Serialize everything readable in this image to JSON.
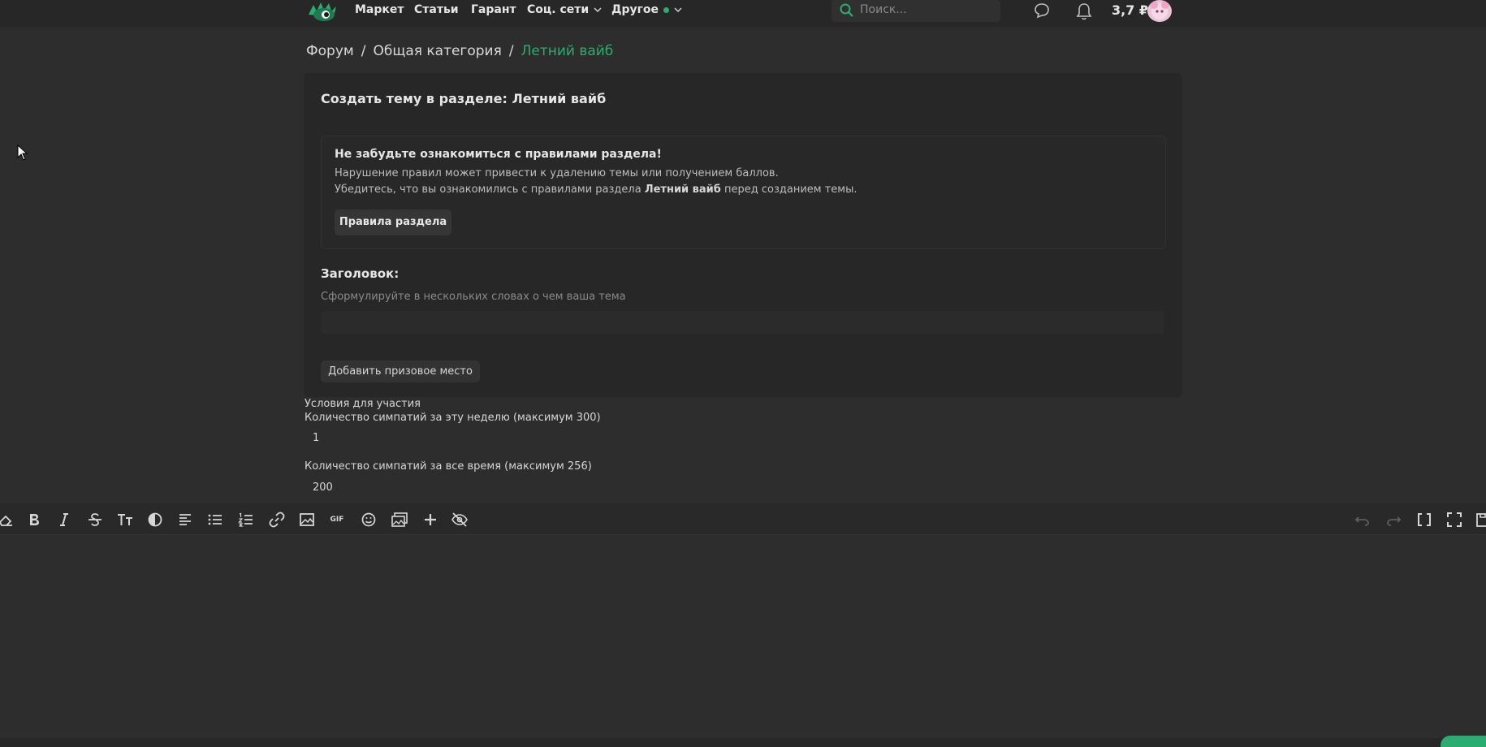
{
  "nav": {
    "items": [
      "Маркет",
      "Статьи",
      "Гарант",
      "Соц. сети",
      "Другое"
    ],
    "search_placeholder": "Поиск...",
    "balance": "3,7 ₽"
  },
  "breadcrumb": {
    "items": [
      "Форум",
      "Общая категория",
      "Летний вайб"
    ],
    "separator": "/"
  },
  "form": {
    "title": "Создать тему в разделе: Летний вайб",
    "notice": {
      "title": "Не забудьте ознакомиться с правилами раздела!",
      "line1": "Нарушение правил может привести к удалению темы или получением баллов.",
      "line2_prefix": "Убедитесь, что вы ознакомились с правилами раздела ",
      "line2_bold": "Летний вайб",
      "line2_suffix": " перед созданием темы.",
      "button": "Правила раздела"
    },
    "heading_label": "Заголовок:",
    "heading_hint": "Сформулируйте в нескольких словах о чем ваша тема",
    "heading_value": "",
    "prize_button": "Добавить призовое место"
  },
  "conditions": {
    "title": "Условия для участия",
    "week_label": "Количество симпатий за эту неделю (максимум 300)",
    "week_value": "1",
    "all_label": "Количество симпатий за все время (максимум 256)",
    "all_value": "200"
  },
  "editor": {
    "toolbar_left": [
      "eraser-icon",
      "bold-icon",
      "italic-icon",
      "strikethrough-icon",
      "text-size-icon",
      "color-icon",
      "align-icon",
      "bullet-list-icon",
      "numbered-list-icon",
      "link-icon",
      "image-icon",
      "gif-icon",
      "emoji-icon",
      "media-icon",
      "plus-icon",
      "hide-icon"
    ],
    "toolbar_right": [
      "undo-icon",
      "redo-icon",
      "bbcode-icon",
      "fullscreen-icon",
      "drafts-icon"
    ],
    "gif_text": "GIF"
  },
  "colors": {
    "accent": "#2bad72",
    "background": "#2d2d2d",
    "panel": "#272727"
  }
}
